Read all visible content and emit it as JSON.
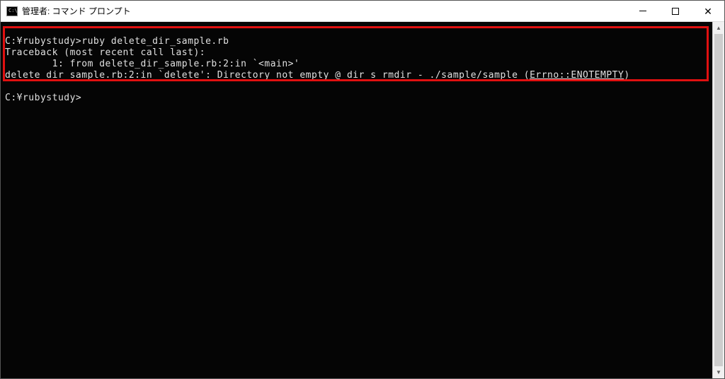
{
  "window": {
    "icon_label": "C:\\",
    "title": "管理者: コマンド プロンプト"
  },
  "terminal": {
    "lines": {
      "l1_prompt": "C:¥rubystudy>",
      "l1_cmd": "ruby delete_dir_sample.rb",
      "l2": "Traceback (most recent call last):",
      "l3": "        1: from delete_dir_sample.rb:2:in `<main>'",
      "l4_a": "delete_dir_sample.rb:2:in `delete': Directory not empty @ dir_s_rmdir - ./sample/sample (",
      "l4_err": "Errno::ENOTEMPTY",
      "l4_b": ")",
      "l6_prompt": "C:¥rubystudy>"
    }
  },
  "controls": {
    "minimize": "minimize",
    "maximize": "maximize",
    "close": "close"
  }
}
